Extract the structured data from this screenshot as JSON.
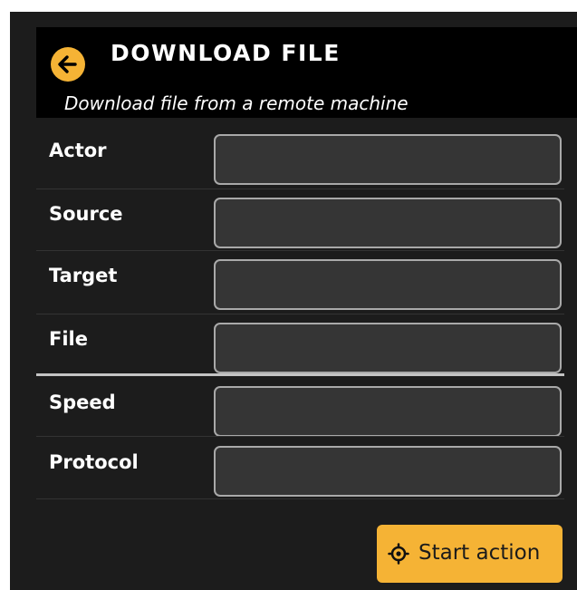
{
  "colors": {
    "accent": "#f5b335",
    "panel": "#1c1c1c",
    "header": "#000000",
    "field": "#353535"
  },
  "header": {
    "back_icon": "arrow-left-icon",
    "title": "DOWNLOAD FILE",
    "subtitle": "Download file from a remote machine"
  },
  "fields": [
    {
      "label": "Actor",
      "value": ""
    },
    {
      "label": "Source",
      "value": ""
    },
    {
      "label": "Target",
      "value": ""
    },
    {
      "label": "File",
      "value": ""
    },
    {
      "label": "Speed",
      "value": ""
    },
    {
      "label": "Protocol",
      "value": ""
    }
  ],
  "footer": {
    "start_icon": "crosshair-icon",
    "start_label": "Start action"
  }
}
